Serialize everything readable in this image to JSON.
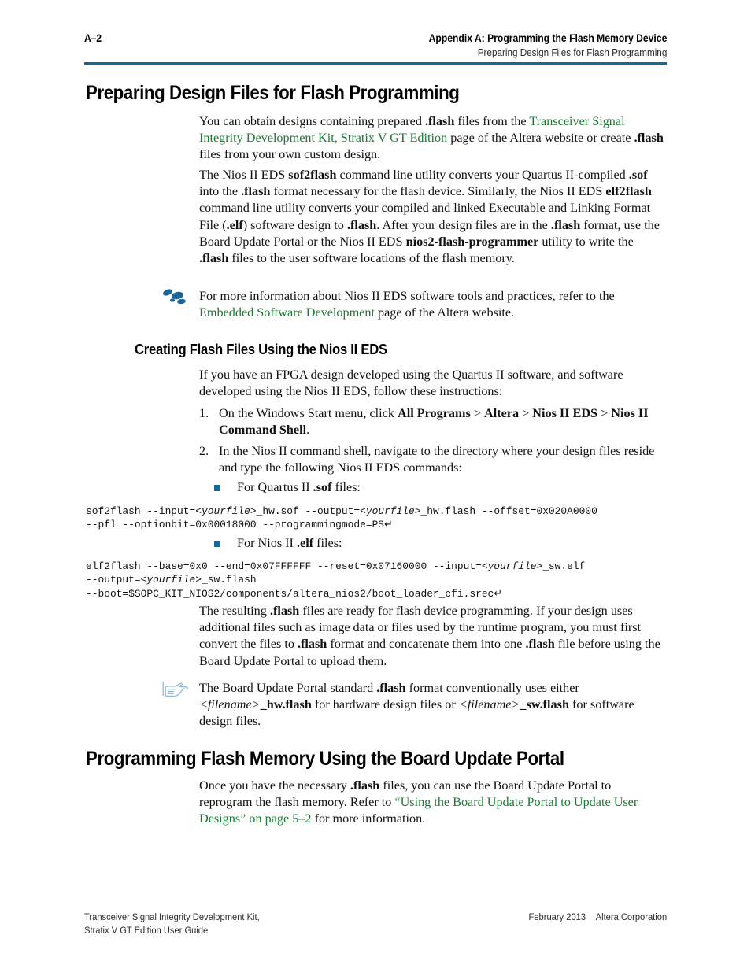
{
  "header": {
    "page_number": "A–2",
    "appendix_title": "Appendix A:  Programming the Flash Memory Device",
    "section_subtitle": "Preparing Design Files for Flash Programming",
    "rule_color": "#1a6699"
  },
  "colors": {
    "link_green": "#1a7a32",
    "accent_blue": "#1a6699",
    "hand_icon_blue": "#8fb8d6"
  },
  "section1": {
    "heading": "Preparing Design Files for Flash Programming",
    "para1": {
      "t1": "You can obtain designs containing prepared ",
      "b1": ".flash",
      "t2": " files from the ",
      "link1": "Transceiver Signal Integrity Development Kit, Stratix V GT Edition",
      "t3": " page of the Altera website or create ",
      "b2": ".flash",
      "t4": " files from your own custom design."
    },
    "para2": {
      "t1": "The Nios II EDS ",
      "b1": "sof2flash",
      "t2": " command line utility converts your Quartus II-compiled ",
      "b2": ".sof",
      "t3": " into the ",
      "b3": ".flash",
      "t4": " format necessary for the flash device. Similarly, the Nios II EDS ",
      "b4": "elf2flash",
      "t5": " command line utility converts your compiled and linked Executable and Linking Format File (",
      "b5": ".elf",
      "t6": ") software design to ",
      "b6": ".flash",
      "t7": ". After your design files are in the ",
      "b7": ".flash",
      "t8": " format, use the Board Update Portal or the Nios II EDS ",
      "b8": "nios2-flash-programmer",
      "t9": " utility to write the ",
      "b9": ".flash",
      "t10": " files to the user software locations of the flash memory."
    },
    "note1": {
      "icon": "footprints-icon",
      "t1": "For more information about Nios II EDS software tools and practices, refer to the ",
      "link1": "Embedded Software Development",
      "t2": " page of the Altera website."
    }
  },
  "subsection1": {
    "heading": "Creating Flash Files Using the Nios II EDS",
    "intro": "If you have an FPGA design developed using the Quartus II software, and software developed using the Nios II EDS, follow these instructions:",
    "step1": {
      "num": "1.",
      "t1": "On the Windows Start menu, click ",
      "b1": "All Programs",
      "t2": " > ",
      "b2": "Altera",
      "t3": " > ",
      "b3": "Nios II EDS",
      "t4": " > ",
      "b4": "Nios II Command Shell",
      "t5": "."
    },
    "step2": {
      "num": "2.",
      "t1": "In the Nios II command shell, navigate to the directory where your design files reside and type the following Nios II EDS commands:"
    },
    "bullet1": {
      "t1": "For Quartus II ",
      "b1": ".sof",
      "t2": " files:"
    },
    "code1": {
      "l1a": "sof2flash --input=<",
      "l1i": "yourfile",
      "l1b": ">_hw.sof --output=<",
      "l1i2": "yourfile",
      "l1c": ">_hw.flash --offset=0x020A0000",
      "l2": "--pfl --optionbit=0x00018000 --programmingmode=PS",
      "cr": "↵"
    },
    "bullet2": {
      "t1": "For Nios II ",
      "b1": ".elf",
      "t2": " files:"
    },
    "code2": {
      "l1a": "elf2flash --base=0x0 --end=0x07FFFFFF --reset=0x07160000 --input=<",
      "l1i": "yourfile",
      "l1b": ">_sw.elf",
      "l2a": "--output=<",
      "l2i": "yourfile",
      "l2b": ">_sw.flash",
      "l3": "--boot=$SOPC_KIT_NIOS2/components/altera_nios2/boot_loader_cfi.srec",
      "cr": "↵"
    },
    "para_after": {
      "t1": "The resulting ",
      "b1": ".flash",
      "t2": " files are ready for flash device programming. If your design uses additional files such as image data or files used by the runtime program, you must first convert the files to ",
      "b2": ".flash",
      "t3": " format and concatenate them into one ",
      "b3": ".flash",
      "t4": " file before using the Board Update Portal to upload them."
    },
    "note2": {
      "icon": "pointing-hand-icon",
      "t1": "The Board Update Portal standard ",
      "b1": ".flash",
      "t2": " format conventionally uses either ",
      "i1": "<filename>",
      "b2": "_hw.flash",
      "t3": " for hardware design files or ",
      "i2": "<filename>",
      "b3": "_sw.flash",
      "t4": " for software design files."
    }
  },
  "section2": {
    "heading": "Programming Flash Memory Using the Board Update Portal",
    "para1": {
      "t1": "Once you have the necessary ",
      "b1": ".flash",
      "t2": " files, you can use the Board Update Portal to reprogram the flash memory. Refer to ",
      "link1": "“Using the Board Update Portal to Update User Designs” on page 5–2",
      "t3": " for more information."
    }
  },
  "footer": {
    "left_line1": "Transceiver Signal Integrity Development Kit,",
    "left_line2": "Stratix V GT Edition User Guide",
    "right_date": "February 2013",
    "right_company": "Altera Corporation"
  }
}
